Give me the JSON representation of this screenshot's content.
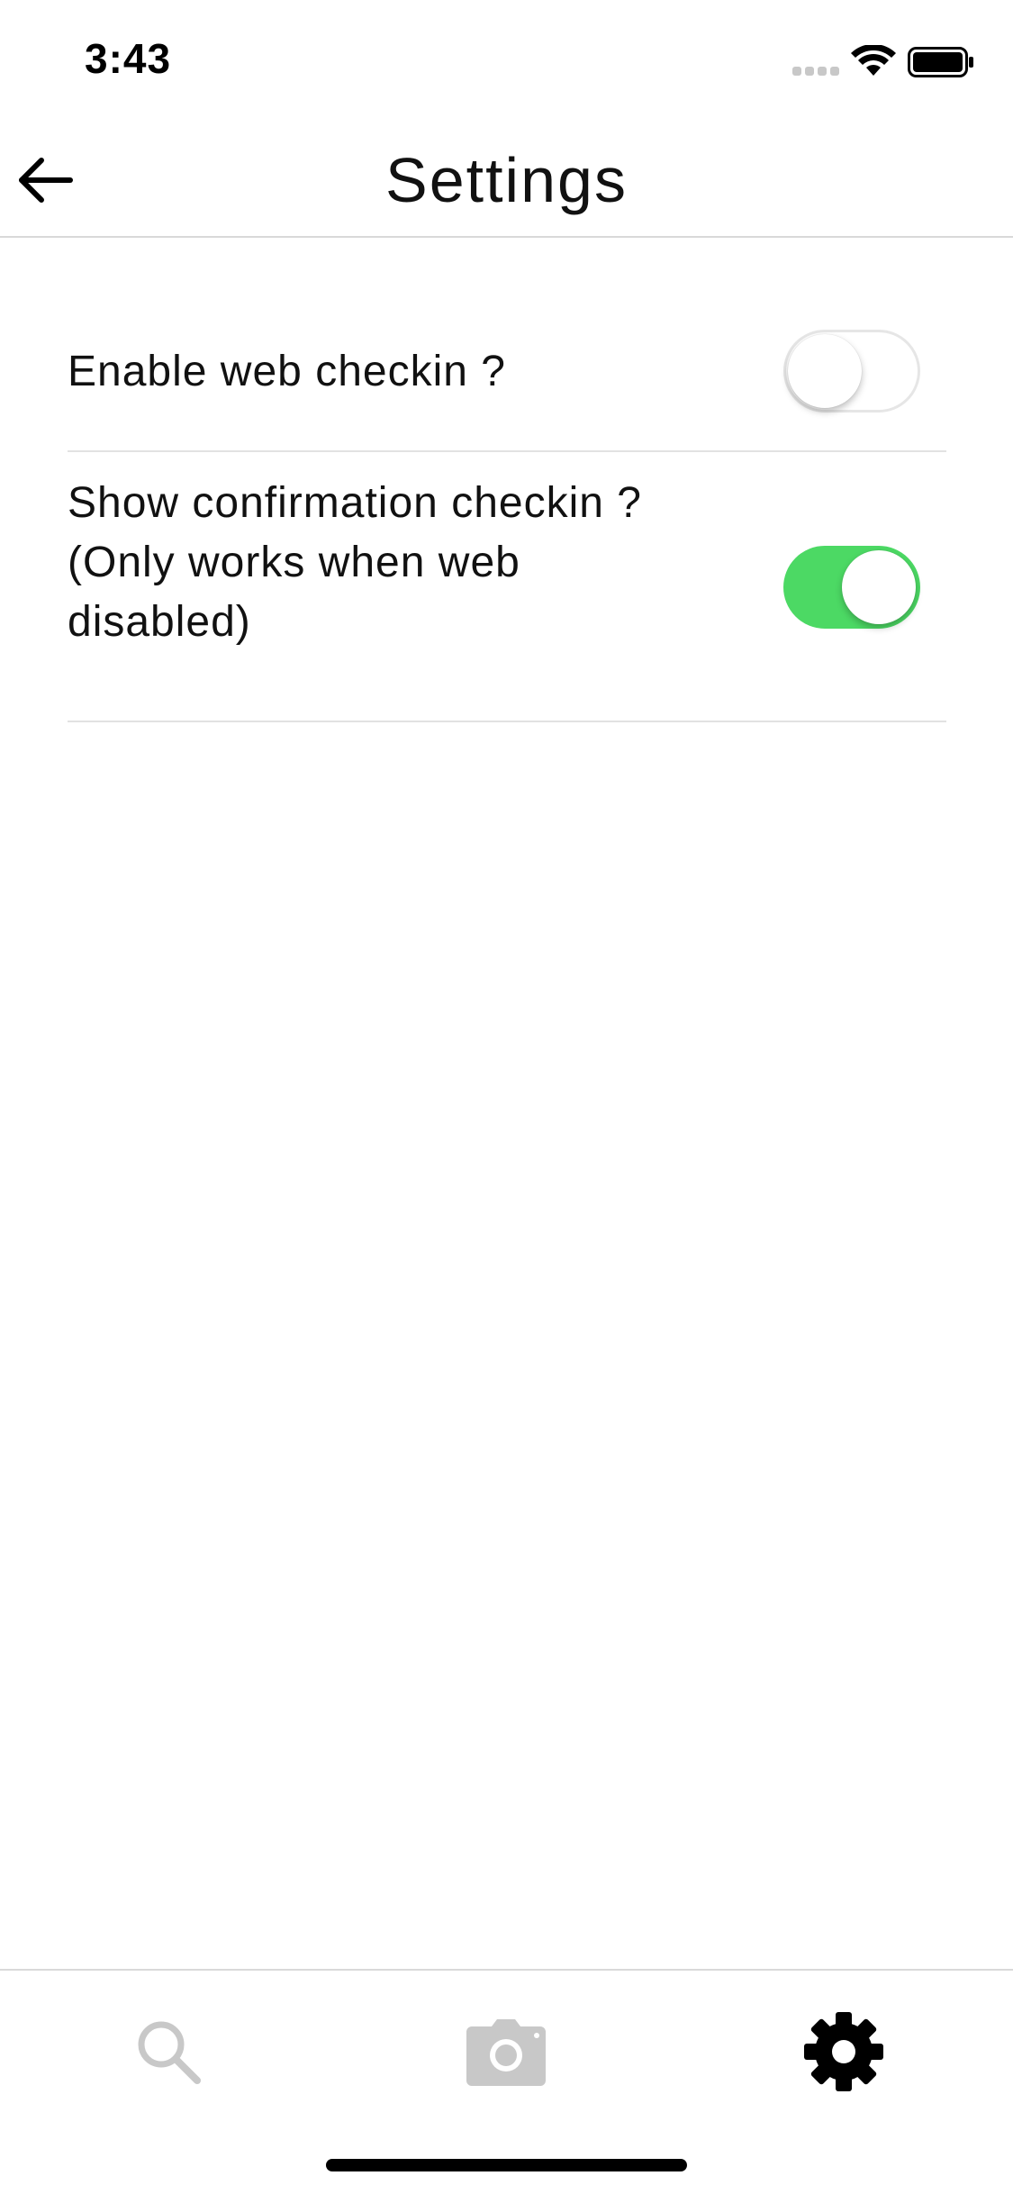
{
  "status_bar": {
    "time": "3:43"
  },
  "header": {
    "title": "Settings",
    "back_icon": "arrow-left-icon"
  },
  "settings": [
    {
      "label": "Enable web checkin ?",
      "enabled": false
    },
    {
      "label": "Show confirmation checkin ?\n(Only works when web\ndisabled)",
      "enabled": true
    }
  ],
  "tab_bar": {
    "tabs": [
      {
        "icon": "search-icon",
        "active": false
      },
      {
        "icon": "camera-icon",
        "active": false
      },
      {
        "icon": "gear-icon",
        "active": true
      }
    ]
  },
  "colors": {
    "toggle_on": "#4cd964",
    "tab_inactive": "#c8c8c8",
    "tab_active": "#000000",
    "divider": "#e2e2e2"
  }
}
